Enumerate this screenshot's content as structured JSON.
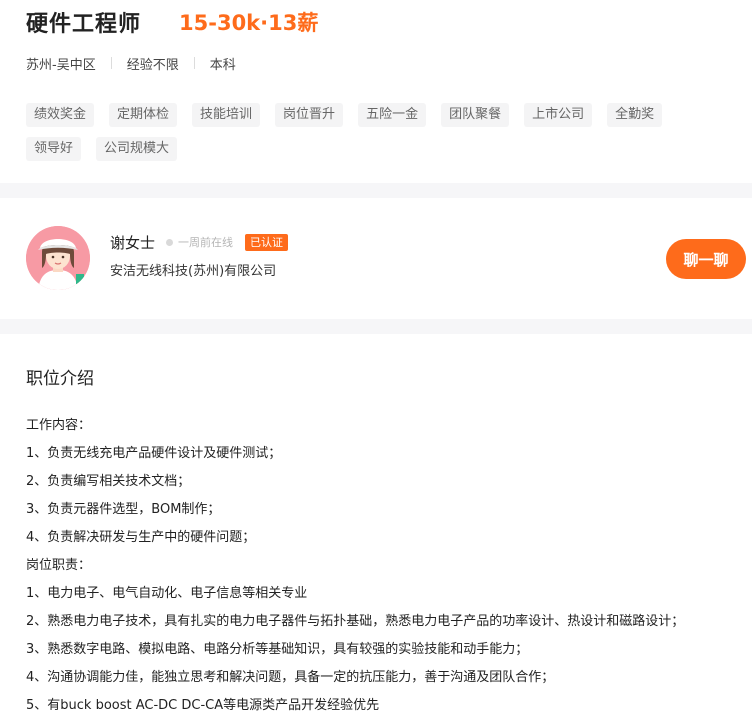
{
  "job": {
    "title": "硬件工程师",
    "salary": "15-30k·13薪",
    "location": "苏州-吴中区",
    "experience": "经验不限",
    "education": "本科",
    "tags": [
      "绩效奖金",
      "定期体检",
      "技能培训",
      "岗位晋升",
      "五险一金",
      "团队聚餐",
      "上市公司",
      "全勤奖",
      "领导好",
      "公司规模大"
    ]
  },
  "recruiter": {
    "name": "谢女士",
    "online_status": "一周前在线",
    "verified_label": "已认证",
    "company": "安洁无线科技(苏州)有限公司",
    "chat_button": "聊一聊"
  },
  "description": {
    "section_title": "职位介绍",
    "lines": [
      "工作内容：",
      "1、负责无线充电产品硬件设计及硬件测试；",
      "2、负责编写相关技术文档；",
      "3、负责元器件选型，BOM制作；",
      "4、负责解决研发与生产中的硬件问题；",
      "岗位职责：",
      "1、电力电子、电气自动化、电子信息等相关专业",
      "2、熟悉电力电子技术，具有扎实的电力电子器件与拓扑基础，熟悉电力电子产品的功率设计、热设计和磁路设计；",
      "3、熟悉数字电路、模拟电路、电路分析等基础知识，具有较强的实验技能和动手能力；",
      "4、沟通协调能力佳，能独立思考和解决问题，具备一定的抗压能力，善于沟通及团队合作；",
      "5、有buck boost AC-DC DC-CA等电源类产品开发经验优先"
    ]
  },
  "colors": {
    "accent": "#fe6b1b",
    "tag_bg": "#f4f4f5",
    "section_gap": "#f6f6f8"
  }
}
